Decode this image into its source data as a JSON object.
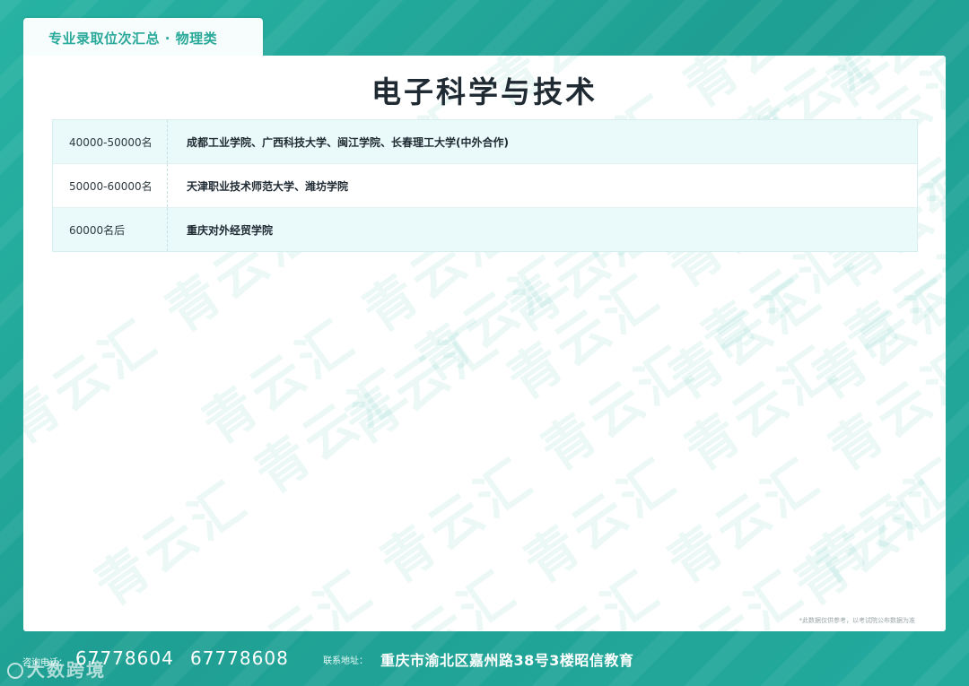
{
  "tab": {
    "label": "专业录取位次汇总 · 物理类"
  },
  "title": "电子科学与技术",
  "table": {
    "rows": [
      {
        "rank": "40000-50000名",
        "schools": "成都工业学院、广西科技大学、闽江学院、长春理工大学(中外合作)"
      },
      {
        "rank": "50000-60000名",
        "schools": "天津职业技术师范大学、潍坊学院"
      },
      {
        "rank": "60000名后",
        "schools": "重庆对外经贸学院"
      }
    ]
  },
  "footnote": "*此数据仅供参考，以考试院公布数据为准",
  "footer": {
    "phone_label": "咨询电话：",
    "phone1": "67778604",
    "phone2": "67778608",
    "address_label": "联系地址：",
    "address": "重庆市渝北区嘉州路38号3楼昭信教育"
  },
  "watermark": {
    "text": "青云汇",
    "corner_logo": "大数跨境"
  },
  "colors": {
    "background": "#21a89b",
    "tab_text": "#2aa99b",
    "row_alt": "#eaf9f9"
  }
}
